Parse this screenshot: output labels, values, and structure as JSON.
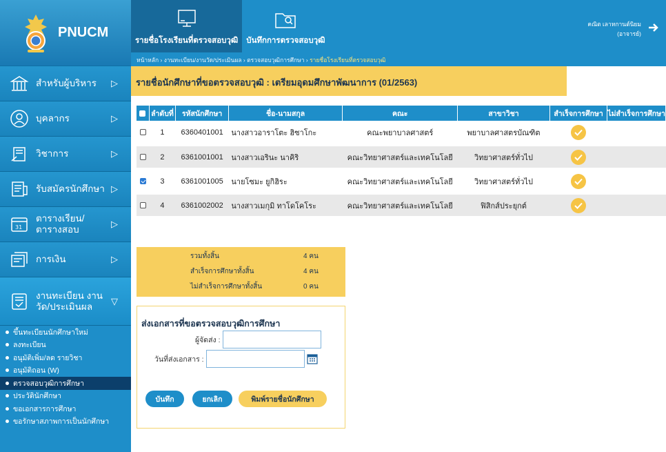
{
  "brand": {
    "name": "PNUCM"
  },
  "sidebar": {
    "items": [
      {
        "label": "สำหรับผู้บริหาร",
        "icon": "building-icon"
      },
      {
        "label": "บุคลากร",
        "icon": "person-icon"
      },
      {
        "label": "วิชาการ",
        "icon": "book-icon"
      },
      {
        "label": "รับสมัครนักศึกษา",
        "icon": "registration-icon"
      },
      {
        "label": "ตารางเรียน/ ตารางสอบ",
        "icon": "calendar-icon"
      },
      {
        "label": "การเงิน",
        "icon": "money-icon"
      },
      {
        "label": "งานทะเบียน งานวัด/ประเมินผล",
        "icon": "register-icon"
      }
    ],
    "subitems": [
      "ขึ้นทะเบียนนักศึกษาใหม่",
      "ลงทะเบียน",
      "อนุมัติเพิ่ม/ลด รายวิชา",
      "อนุมัติถอน (W)",
      "ตรวจสอบวุฒิการศึกษา",
      "ประวัตินักศึกษา",
      "ขอเอกสารการศึกษา",
      "ขอรักษาสภาพการเป็นนักศึกษา"
    ]
  },
  "topbar": {
    "tab1": "รายชื่อโรงเรียนที่ตรวจสอบวุฒิ",
    "tab2": "บันทึกการตรวจสอบวุฒิ",
    "breadcrumb": {
      "home": "หน้าหลัก",
      "sep": "›",
      "level1": "งานทะเบียน/งานวัด/ประเมินผล",
      "level2": "ตรวจสอบวุฒิการศึกษา",
      "current": "รายชื่อโรงเรียนที่ตรวจสอบวุฒิ"
    },
    "user_name": "คณิต เลาหกานต์นิยม",
    "user_role": "(อาจารย์)"
  },
  "page_title": "รายชื่อนักศึกษาที่ขอตรวจสอบวุฒิ : เตรียมอุดมศึกษาพัฒนาการ (01/2563)",
  "table": {
    "headers": {
      "no": "ลำดับที่",
      "student_id": "รหัสนักศึกษา",
      "name": "ชื่อ-นามสกุล",
      "faculty": "คณะ",
      "major": "สาขาวิชา",
      "passed": "สำเร็จการศึกษา",
      "not_passed": "ไม่สำเร็จการศึกษา"
    },
    "rows": [
      {
        "no": "1",
        "id": "6360401001",
        "name": "นางสาวอาราโตะ ฮิซาโกะ",
        "faculty": "คณะพยาบาลศาสตร์",
        "major": "พยาบาลศาสตรบัณฑิต",
        "checked": false
      },
      {
        "no": "2",
        "id": "6361001001",
        "name": "นางสาวเอรินะ นาคิริ",
        "faculty": "คณะวิทยาศาสตร์และเทคโนโลยี",
        "major": "วิทยาศาสตร์ทั่วไป",
        "checked": false
      },
      {
        "no": "3",
        "id": "6361001005",
        "name": "นายโซมะ ยูกิฮิระ",
        "faculty": "คณะวิทยาศาสตร์และเทคโนโลยี",
        "major": "วิทยาศาสตร์ทั่วไป",
        "checked": true
      },
      {
        "no": "4",
        "id": "6361002002",
        "name": "นางสาวเมกุมิ ทาโดโคโระ",
        "faculty": "คณะวิทยาศาสตร์และเทคโนโลยี",
        "major": "ฟิสิกส์ประยุกต์",
        "checked": false
      }
    ]
  },
  "summary": {
    "total_label": "รวมทั้งสิ้น",
    "total_value": "4 คน",
    "passed_label": "สำเร็จการศึกษาทั้งสิ้น",
    "passed_value": "4 คน",
    "failed_label": "ไม่สำเร็จการศึกษาทั้งสิ้น",
    "failed_value": "0 คน"
  },
  "form": {
    "title": "ส่งเอกสารที่ขอตรวจสอบวุฒิการศึกษา",
    "sender_label": "ผู้จัดส่ง :",
    "sender_value": "",
    "date_label": "วันที่ส่งเอกสาร :",
    "date_value": "",
    "save_label": "บันทึก",
    "cancel_label": "ยกเลิก",
    "print_label": "พิมพ์รายชื่อนักศึกษา"
  },
  "colors": {
    "primary": "#1e8ec9",
    "accent": "#f7cf5e",
    "active_nav": "#0c3f6b"
  }
}
